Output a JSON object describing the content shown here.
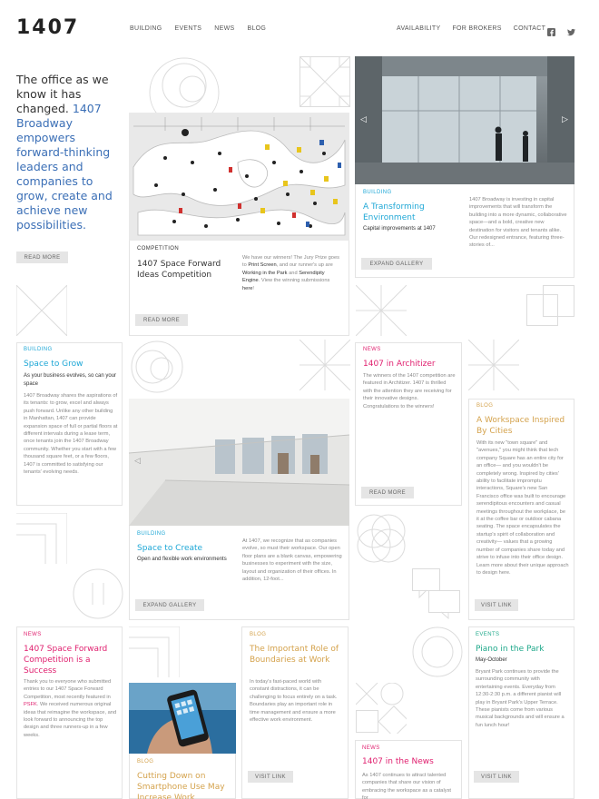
{
  "header": {
    "logo": "1407",
    "nav_left": [
      "BUILDING",
      "EVENTS",
      "NEWS",
      "BLOG"
    ],
    "nav_right": [
      "AVAILABILITY",
      "FOR BROKERS",
      "CONTACT"
    ]
  },
  "hero": {
    "line_dark": "The office as we know it has changed.",
    "line_blue": "1407 Broadway empowers forward-thinking leaders and companies to grow, create and achieve new possibilities.",
    "button": "READ MORE"
  },
  "cards": {
    "competition": {
      "tag": "COMPETITION",
      "title": "1407 Space Forward Ideas Competition",
      "body_1": "We have our winners! The Jury Prize goes to ",
      "link_1": "Print Screen",
      "body_2": ", and our runner's up are ",
      "link_2": "Working in the Park",
      "body_3": " and ",
      "link_3": "Serendipity Engine",
      "body_4": ". View the winning submissions ",
      "link_4": "here",
      "body_5": "!",
      "button": "READ MORE"
    },
    "transforming": {
      "tag": "BUILDING",
      "title": "A Transforming Environment",
      "subtitle": "Capital improvements at 1407",
      "body": "1407 Broadway is investing in capital improvements that will transform the building into a more dynamic, collaborative space—and a bold, creative new destination for visitors and tenants alike. Our redesigned entrance, featuring three-stories of...",
      "button": "EXPAND GALLERY"
    },
    "grow": {
      "tag": "BUILDING",
      "title": "Space to Grow",
      "subtitle": "As your business evolves, so can your space",
      "body": "1407 Broadway shares the aspirations of its tenants: to grow, excel and always push forward. Unlike any other building in Manhattan, 1407 can provide expansion space of full or partial floors at different intervals during a lease term, once tenants join the 1407 Broadway community. Whether you start with a few thousand square feet, or a few floors, 1407 is committed to satisfying our tenants' evolving needs."
    },
    "architizer": {
      "tag": "NEWS",
      "title": "1407 in Architizer",
      "body": "The winners of the 1407 competition are featured in Architizer. 1407 is thrilled with the attention they are receiving for their innovative designs. Congratulations to the winners!",
      "button": "READ MORE"
    },
    "create": {
      "tag": "BUILDING",
      "title": "Space to Create",
      "subtitle": "Open and flexible work environments",
      "body": "At 1407, we recognize that as companies evolve, so must their workspace. Our open floor plans are a blank canvas, empowering businesses to experiment with the size, layout and organization of their offices. In addition, 12-foot...",
      "button": "EXPAND GALLERY"
    },
    "cities": {
      "tag": "BLOG",
      "title": "A Workspace Inspired By Cities",
      "body": "With its new \"town square\" and \"avenues,\" you might think that tech company Square has an entire city for an office— and you wouldn't be completely wrong. Inspired by cities' ability to facilitate impromptu interactions, Square's new San Francisco office was built to encourage serendipitous encounters and casual meetings throughout the workplace, be it at the coffee bar or outdoor cabana seating. The space encapsulates the startup's spirit of collaboration and creativity— values that a growing number of companies share today and strive to infuse into their office design. Learn more about their unique approach to design here.",
      "button": "VISIT LINK"
    },
    "competition_success": {
      "tag": "NEWS",
      "title": "1407 Space Forward Competition is a Success",
      "body_1": "Thank you to everyone who submitted entries to our 1407 Space Forward Competition, most recently featured in ",
      "link_1": "PSFK",
      "body_2": ". We received numerous original ideas that reimagine the workspace, and look forward to announcing the top design and three runners-up in a few weeks."
    },
    "boundaries": {
      "tag": "BLOG",
      "title": "The Important Role of Boundaries at Work",
      "body": "In today's fast-paced world with constant distractions, it can be challenging to focus entirely on a task. Boundaries play an important role in time management and ensure a more effective work environment.",
      "button": "VISIT LINK"
    },
    "piano": {
      "tag": "EVENTS",
      "title": "Piano in the Park",
      "subtitle": "May-October",
      "body": "Bryant Park continues to provide the surrounding community with entertaining events. Everyday from 12:30-2:30 p.m. a different pianist will play in Bryant Park's Upper Terrace. These pianists come from various musical backgrounds and will ensure a fun lunch hour!",
      "button": "VISIT LINK"
    },
    "smartphone": {
      "tag": "BLOG",
      "title": "Cutting Down on Smartphone Use May Increase Work"
    },
    "in_news": {
      "tag": "NEWS",
      "title": "1407 in the News",
      "body": "As 1407 continues to attract talented companies that share our vision of embracing the workspace as a catalyst for"
    }
  },
  "gallery": {
    "prev": "◁",
    "next": "▷"
  },
  "colors": {
    "blue": "#1ea7d6",
    "hero_blue": "#3b6fb6",
    "pink": "#e0206f",
    "gold": "#d4a24c",
    "green": "#1ea88a"
  }
}
